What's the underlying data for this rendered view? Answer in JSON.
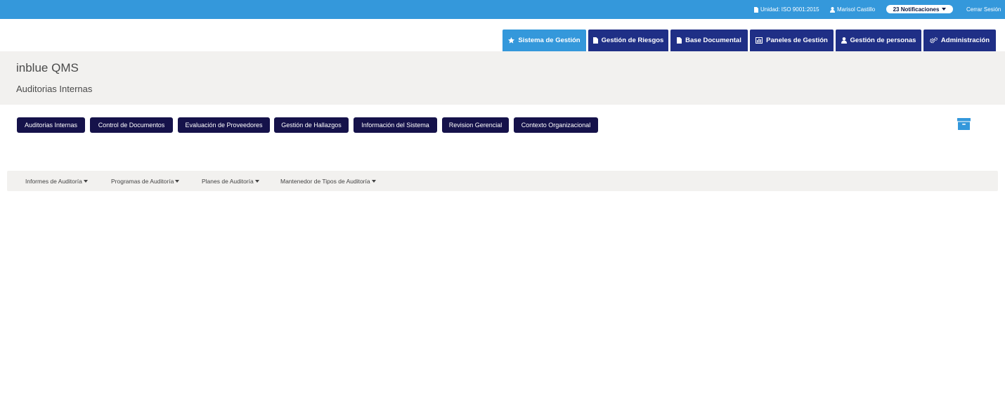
{
  "topbar": {
    "unit_label": "Unidad: ISO 9001:2015",
    "user_name": "Marisol Castillo",
    "notifications_label": "23 Notificaciones",
    "logout_label": "Cerrar Sesión"
  },
  "main_nav": [
    {
      "label": "Sistema de Gestión",
      "icon": "star-icon",
      "active": true
    },
    {
      "label": "Gestión de Riesgos",
      "icon": "document-icon",
      "active": false
    },
    {
      "label": "Base Documental",
      "icon": "document-icon",
      "active": false
    },
    {
      "label": "Paneles de Gestión",
      "icon": "bar-chart-icon",
      "active": false
    },
    {
      "label": "Gestión de personas",
      "icon": "user-icon",
      "active": false
    },
    {
      "label": "Administración",
      "icon": "gears-icon",
      "active": false
    }
  ],
  "header": {
    "app_title": "inblue QMS",
    "page_title": "Auditorias Internas"
  },
  "modules": [
    "Auditorias Internas",
    "Control de Documentos",
    "Evaluación de Proveedores",
    "Gestión de Hallazgos",
    "Información del Sistema",
    "Revision Gerencial",
    "Contexto Organizacional"
  ],
  "archive_icon": "archive-icon",
  "submenu": [
    "Informes de Auditoría",
    "Programas de Auditoría",
    "Planes de Auditoría",
    "Mantenedor de Tipos de Auditoría"
  ],
  "colors": {
    "topbar": "#3498db",
    "nav_tab": "#1f2f86",
    "nav_tab_active": "#3498db",
    "module_button": "#15124a",
    "band": "#f2f1ef"
  }
}
